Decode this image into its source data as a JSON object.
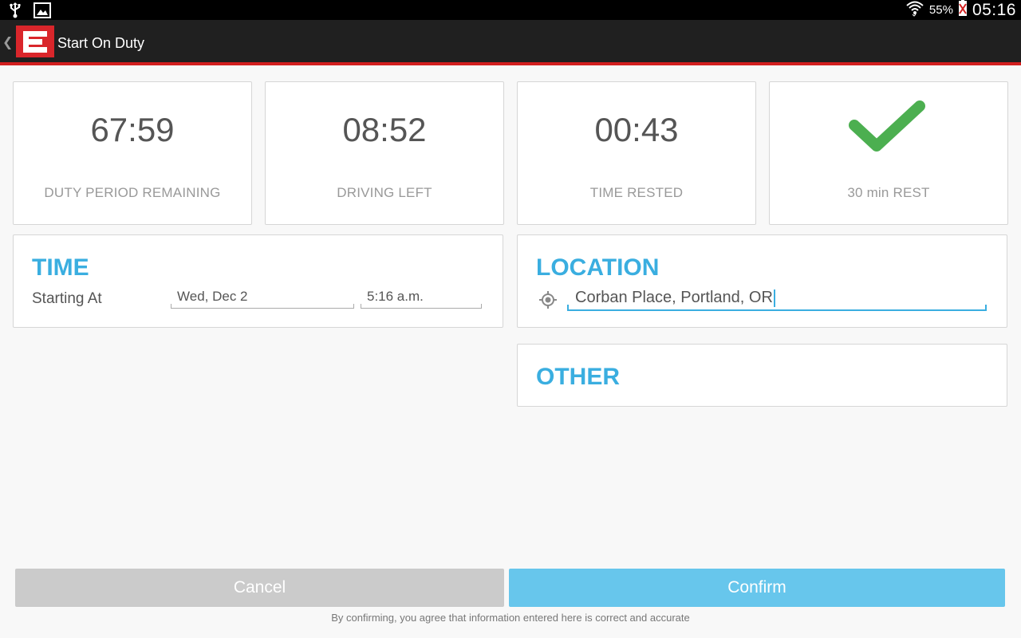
{
  "statusbar": {
    "battery_pct": "55%",
    "time": "05:16",
    "icons": [
      "usb-icon",
      "image-notification-icon",
      "wifi-icon",
      "battery-icon"
    ]
  },
  "actionbar": {
    "title": "Start On Duty",
    "back_icon": "back-chevron-icon",
    "logo": "app-logo"
  },
  "stats": [
    {
      "value": "67:59",
      "label": "DUTY PERIOD REMAINING"
    },
    {
      "value": "08:52",
      "label": "DRIVING LEFT"
    },
    {
      "value": "00:43",
      "label": "TIME RESTED"
    },
    {
      "value": "",
      "label": "30 min REST",
      "icon": "checkmark-icon"
    }
  ],
  "time_panel": {
    "title": "TIME",
    "field_label": "Starting At",
    "date_value": "Wed, Dec 2",
    "time_value": "5:16 a.m."
  },
  "location_panel": {
    "title": "LOCATION",
    "value": "Corban Place, Portland, OR",
    "icon": "gps-locate-icon"
  },
  "other_panel": {
    "title": "OTHER"
  },
  "buttons": {
    "cancel": "Cancel",
    "confirm": "Confirm"
  },
  "disclaimer": "By confirming, you agree that information entered here is correct and accurate",
  "colors": {
    "accent": "#3aaee0",
    "confirm": "#67c6ec",
    "cancel": "#cbcbcb",
    "brand_red": "#d9262b",
    "check_green": "#4caf50"
  }
}
